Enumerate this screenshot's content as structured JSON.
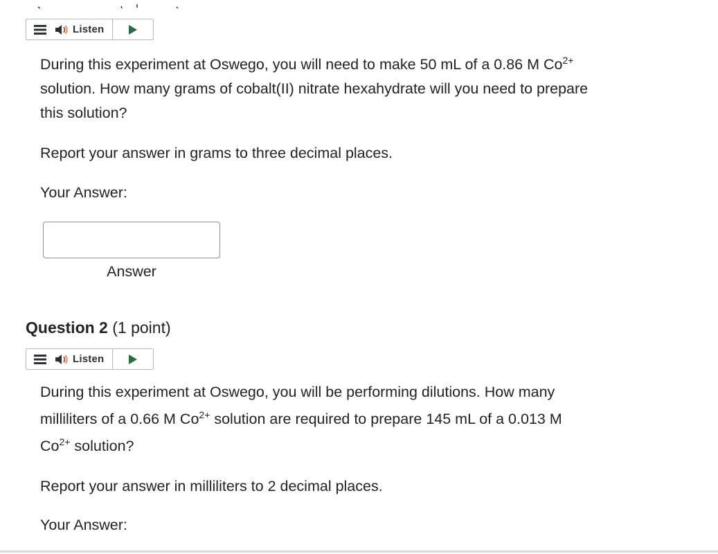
{
  "listen_bar": {
    "label": "Listen"
  },
  "question1": {
    "text_line1": "During this experiment at Oswego, you will need to make 50 mL of a 0.86 M Co",
    "sup1": "2+",
    "text_line2": "solution. How many grams of cobalt(II) nitrate hexahydrate will you need to prepare",
    "text_line3": "this solution?",
    "instruction": "Report your answer in grams to three decimal places.",
    "your_answer_label": "Your Answer:",
    "answer_input_value": "",
    "answer_caption": "Answer"
  },
  "question2": {
    "heading": "Question 2",
    "points": "(1 point)",
    "text_line1": "During this experiment at Oswego, you will be performing dilutions. How many",
    "text_line2_a": "milliliters of a 0.66 M Co",
    "sup_a": "2+",
    "text_line2_b": " solution are required to prepare 145 mL of a 0.013 M",
    "text_line3_a": "Co",
    "sup_b": "2+",
    "text_line3_b": " solution?",
    "instruction": "Report your answer in milliliters to 2 decimal places.",
    "your_answer_label": "Your Answer:"
  },
  "colors": {
    "play": "#2a6e3f",
    "icon": "#2b2f33",
    "border": "#b5b9bd"
  }
}
